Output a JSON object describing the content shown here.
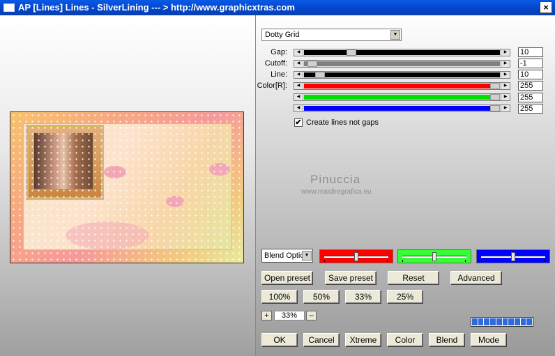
{
  "window": {
    "title": "AP [Lines]  Lines - SilverLining    --- > http://www.graphicxtras.com",
    "close_label": "×"
  },
  "preview": {
    "watermark": "Pinuccia",
    "watermark_sub": "www.maidiregrafica.eu"
  },
  "effect": {
    "selected": "Dotty Grid"
  },
  "params": [
    {
      "label": "Gap:",
      "value": "10",
      "track_color": "#000000",
      "thumb_fraction": 0.23
    },
    {
      "label": "Cutoff:",
      "value": "-1",
      "track_color": "#808080",
      "thumb_fraction": 0.02
    },
    {
      "label": "Line:",
      "value": "10",
      "track_color": "#000000",
      "thumb_fraction": 0.06
    },
    {
      "label": "Color[R]:",
      "value": "255",
      "track_color": "#ff0000",
      "thumb_fraction": 1.0
    },
    {
      "label": "",
      "value": "255",
      "track_color": "#00e000",
      "thumb_fraction": 1.0
    },
    {
      "label": "",
      "value": "255",
      "track_color": "#0000ff",
      "thumb_fraction": 1.0
    }
  ],
  "checkbox": {
    "label": "Create lines not gaps",
    "checked": true,
    "mark": "✔"
  },
  "blend": {
    "label": "Blend Options",
    "mini_sliders": [
      {
        "color": "#ff0000",
        "value_fraction": 0.5
      },
      {
        "color": "#33ff33",
        "value_fraction": 0.5
      },
      {
        "color": "#0000ff",
        "value_fraction": 0.5
      }
    ]
  },
  "buttons": {
    "open_preset": "Open preset",
    "save_preset": "Save preset",
    "reset": "Reset",
    "advanced": "Advanced",
    "zoom_100": "100%",
    "zoom_50": "50%",
    "zoom_33": "33%",
    "zoom_25": "25%",
    "ok": "OK",
    "cancel": "Cancel",
    "xtreme": "Xtreme",
    "color": "Color",
    "blend": "Blend",
    "mode": "Mode"
  },
  "zoom": {
    "plus": "+",
    "value": "33%",
    "minus": "–"
  },
  "progress": {
    "segments": 10,
    "fraction": 1.0
  }
}
